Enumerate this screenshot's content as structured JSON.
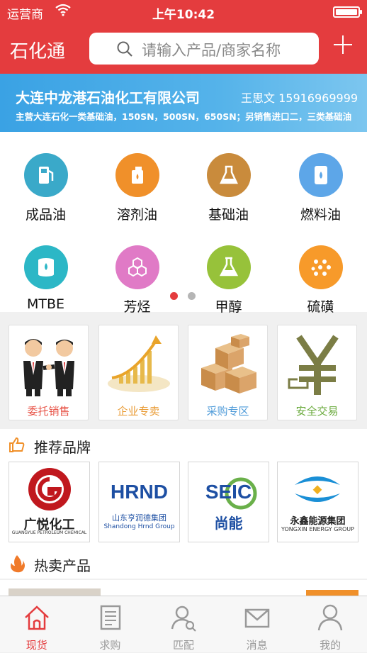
{
  "status_bar": {
    "carrier": "运营商",
    "time": "上午10:42",
    "battery_level": 1.0
  },
  "nav": {
    "title": "石化通",
    "search_placeholder": "请输入产品/商家名称"
  },
  "banner": {
    "company": "大连中龙港石油化工有限公司",
    "contact": "王思文 15916969999",
    "description": "主营大连石化一类基础油，150SN，500SN，650SN；另销售进口二，三类基础油"
  },
  "categories": [
    {
      "label": "成品油",
      "icon": "fuel-pump-icon",
      "color": "#3aa9c9"
    },
    {
      "label": "溶剂油",
      "icon": "oil-can-icon",
      "color": "#f0902a"
    },
    {
      "label": "基础油",
      "icon": "flask-icon",
      "color": "#c98b3c"
    },
    {
      "label": "燃料油",
      "icon": "barrel-icon",
      "color": "#5da6e8"
    },
    {
      "label": "MTBE",
      "icon": "barrel-drop-icon",
      "color": "#2cb7c6"
    },
    {
      "label": "芳烃",
      "icon": "hexagon-molecule-icon",
      "color": "#e07ac6"
    },
    {
      "label": "甲醇",
      "icon": "beaker-icon",
      "color": "#97c23a"
    },
    {
      "label": "硫磺",
      "icon": "dots-grid-icon",
      "color": "#f79a2a"
    }
  ],
  "page_dots": {
    "count": 2,
    "active": 0,
    "active_color": "#e43c3e",
    "inactive_color": "#b5b5b5"
  },
  "features": [
    {
      "label": "委托销售",
      "color": "#e8564a",
      "icon": "handshake-people-icon"
    },
    {
      "label": "企业专卖",
      "color": "#e99b34",
      "icon": "growth-chart-icon"
    },
    {
      "label": "采购专区",
      "color": "#4f9bd9",
      "icon": "boxes-icon"
    },
    {
      "label": "安全交易",
      "color": "#6aaa3c",
      "icon": "yuan-icon"
    }
  ],
  "brands_section": {
    "title": "推荐品牌",
    "icon": "thumbs-up-icon"
  },
  "brands": [
    {
      "name": "广悦化工",
      "sub": "GUANGYUE PETROLEUM CHEMICAL",
      "logo": "G"
    },
    {
      "name": "HRND",
      "sub": "山东亨润德集团",
      "sub2": "Shandong Hrnd Group"
    },
    {
      "name": "SEIC",
      "sub": "尚能"
    },
    {
      "name": "永鑫能源集团",
      "sub": "YONGXIN ENERGY GROUP"
    }
  ],
  "hot_section": {
    "title": "热卖产品",
    "icon": "flame-icon"
  },
  "tabs": [
    {
      "label": "现货",
      "icon": "home-icon",
      "active": true
    },
    {
      "label": "求购",
      "icon": "document-icon",
      "active": false
    },
    {
      "label": "匹配",
      "icon": "user-search-icon",
      "active": false
    },
    {
      "label": "消息",
      "icon": "envelope-icon",
      "active": false
    },
    {
      "label": "我的",
      "icon": "person-icon",
      "active": false
    }
  ],
  "colors": {
    "brand_red": "#e43c3e",
    "tab_active": "#e43c3e",
    "tab_inactive": "#999999"
  }
}
